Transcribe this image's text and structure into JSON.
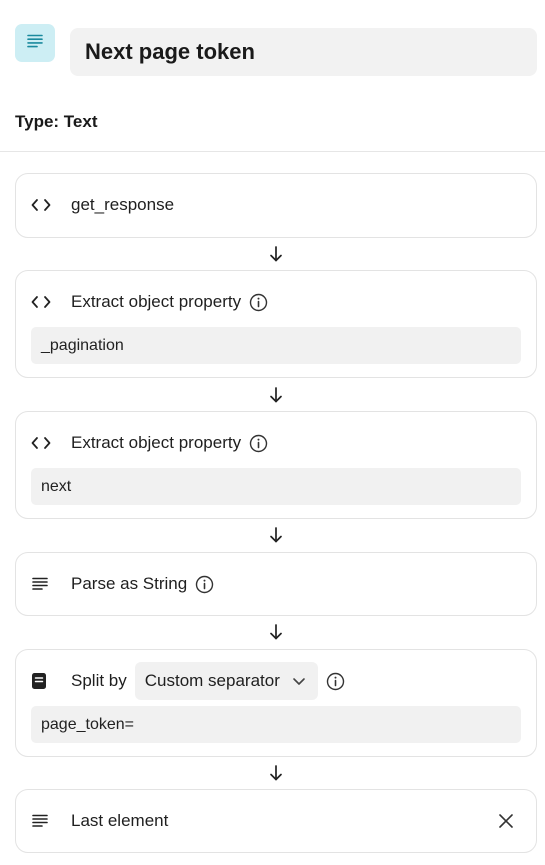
{
  "header": {
    "title": "Next page token",
    "type_label": "Type: Text",
    "icon": "text-lines-icon",
    "accent_bg": "#cdeef4",
    "accent_fg": "#1b8a9e"
  },
  "steps": [
    {
      "icon": "code-brackets-icon",
      "label": "get_response"
    },
    {
      "icon": "code-brackets-icon",
      "label": "Extract object property",
      "value": "_pagination",
      "has_info": true
    },
    {
      "icon": "code-brackets-icon",
      "label": "Extract object property",
      "value": "next",
      "has_info": true
    },
    {
      "icon": "text-lines-icon",
      "label": "Parse as String",
      "has_info": true
    },
    {
      "icon": "note-icon",
      "label": "Split by",
      "separator_option": "Custom separator",
      "value": "page_token=",
      "has_info": true
    },
    {
      "icon": "text-lines-icon",
      "label": "Last element",
      "removable": true
    }
  ],
  "connector_icon": "arrow-down-icon"
}
